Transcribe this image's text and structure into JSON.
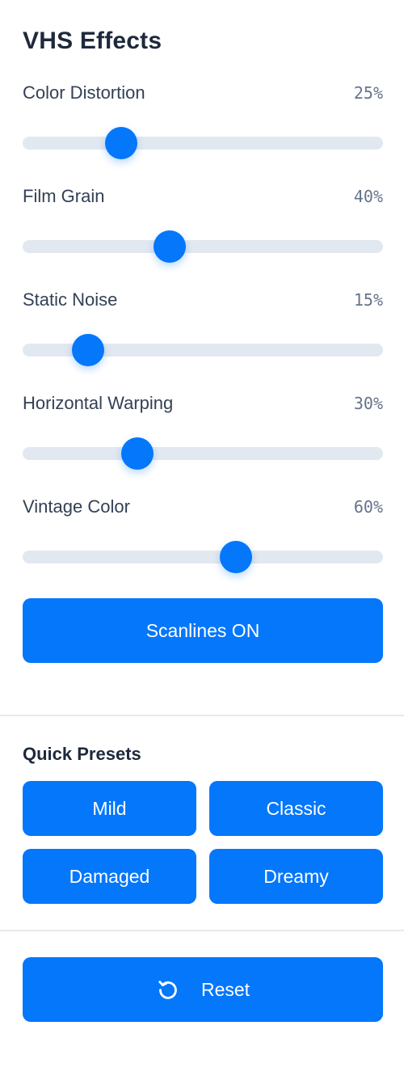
{
  "panel": {
    "title": "VHS Effects"
  },
  "sliders": [
    {
      "label": "Color Distortion",
      "value_text": "25%",
      "value": 25
    },
    {
      "label": "Film Grain",
      "value_text": "40%",
      "value": 40
    },
    {
      "label": "Static Noise",
      "value_text": "15%",
      "value": 15
    },
    {
      "label": "Horizontal Warping",
      "value_text": "30%",
      "value": 30
    },
    {
      "label": "Vintage Color",
      "value_text": "60%",
      "value": 60
    }
  ],
  "scanlines": {
    "label": "Scanlines ON"
  },
  "presets": {
    "title": "Quick Presets",
    "items": [
      "Mild",
      "Classic",
      "Damaged",
      "Dreamy"
    ]
  },
  "reset": {
    "label": "Reset",
    "icon": "reset-icon"
  },
  "colors": {
    "accent": "#0477fb",
    "track": "#e2e8f0",
    "text": "#1e293b"
  }
}
